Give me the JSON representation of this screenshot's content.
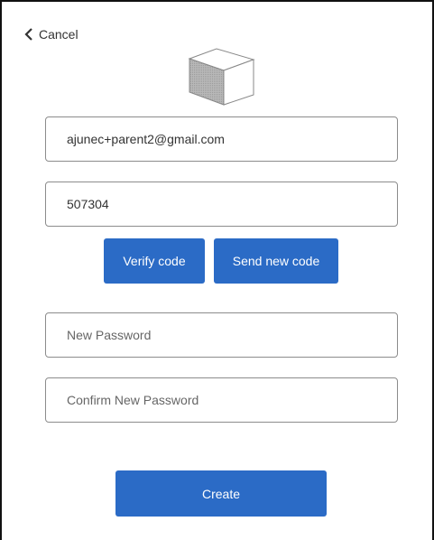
{
  "header": {
    "cancel_label": "Cancel",
    "back_icon": "chevron-left-icon",
    "logo_icon": "cube-logo-icon"
  },
  "form": {
    "email_value": "ajunec+parent2@gmail.com",
    "code_value": "507304",
    "verify_label": "Verify code",
    "send_new_label": "Send new code",
    "new_password_placeholder": "New Password",
    "confirm_password_placeholder": "Confirm New Password",
    "create_label": "Create"
  },
  "colors": {
    "primary_button": "#2b6bc6",
    "field_border": "#8c8c8c"
  }
}
